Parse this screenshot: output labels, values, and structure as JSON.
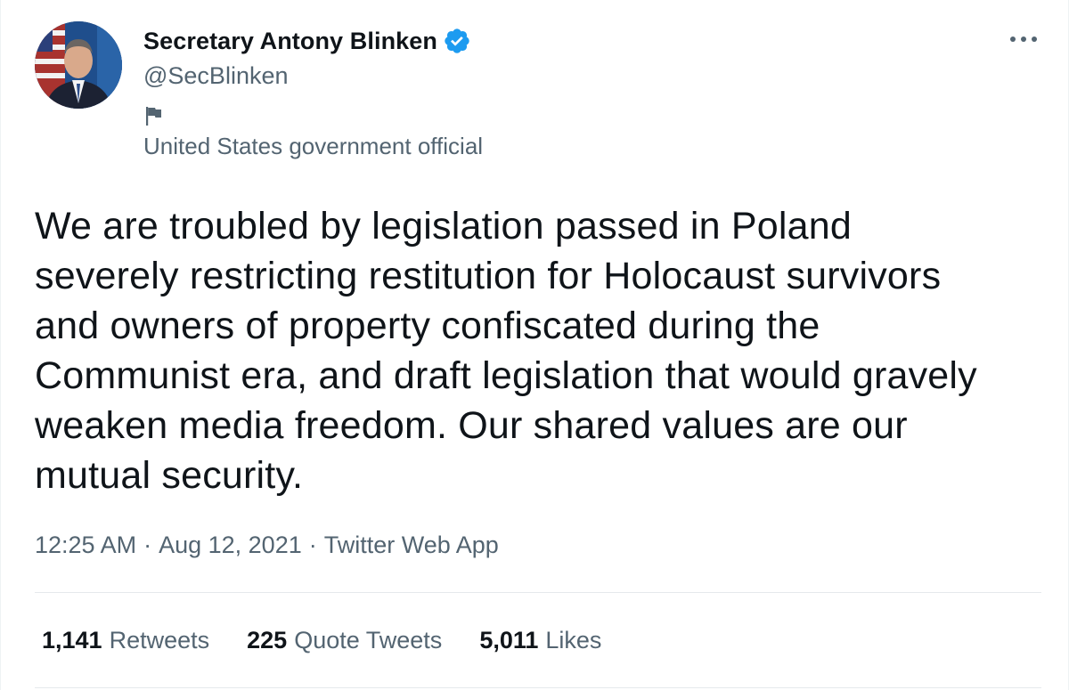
{
  "author": {
    "display_name": "Secretary Antony Blinken",
    "handle": "@SecBlinken",
    "verified": true,
    "label": "United States government official",
    "label_icon": "flag-icon",
    "avatar": "profile-photo"
  },
  "tweet": {
    "text": "We are troubled by legislation passed in Poland\nseverely restricting restitution for Holocaust survivors\nand owners of property confiscated during the\nCommunist era, and draft legislation that would gravely\nweaken media freedom. Our shared values are our\nmutual security.",
    "time": "12:25 AM",
    "date": "Aug 12, 2021",
    "source": "Twitter Web App",
    "separator": "·"
  },
  "stats": {
    "retweets_count": "1,141",
    "retweets_label": "Retweets",
    "quote_tweets_count": "225",
    "quote_tweets_label": "Quote Tweets",
    "likes_count": "5,011",
    "likes_label": "Likes"
  },
  "colors": {
    "text_primary": "#0f1419",
    "text_secondary": "#536471",
    "verified_blue": "#1d9bf0",
    "divider": "#e5e9ec"
  }
}
